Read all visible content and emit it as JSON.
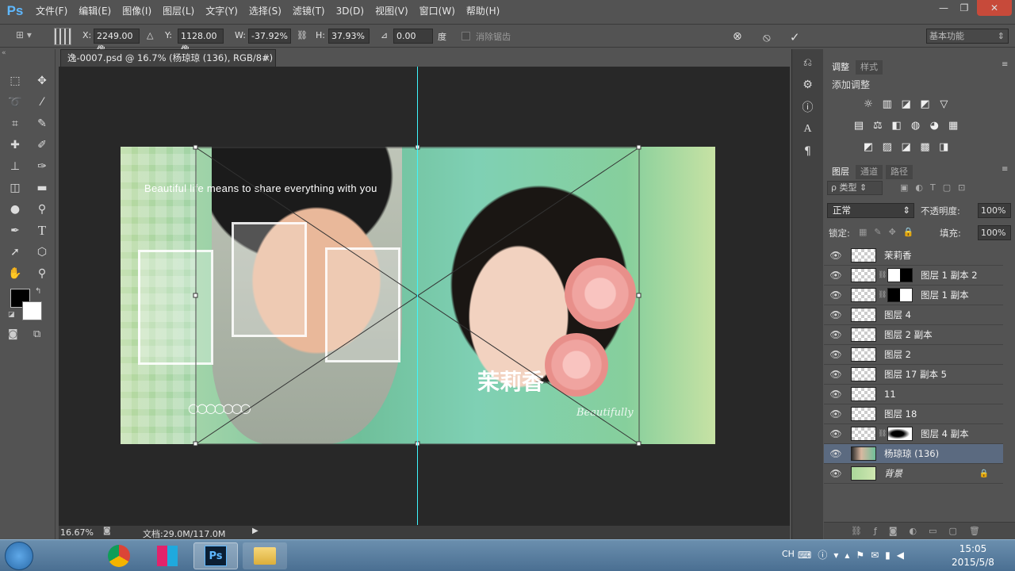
{
  "app": {
    "logo": "Ps"
  },
  "menu": [
    "文件(F)",
    "编辑(E)",
    "图像(I)",
    "图层(L)",
    "文字(Y)",
    "选择(S)",
    "滤镜(T)",
    "3D(D)",
    "视图(V)",
    "窗口(W)",
    "帮助(H)"
  ],
  "window_controls": [
    "—",
    "❐",
    "✕"
  ],
  "options": {
    "x_label": "X:",
    "x_value": "2249.00 像",
    "y_label": "Y:",
    "y_value": "1128.00 像",
    "w_label": "W:",
    "w_value": "-37.92%",
    "h_label": "H:",
    "h_value": "37.93%",
    "angle_value": "0.00",
    "angle_unit": "度",
    "antialias_label": "消除锯齿",
    "workspace": "基本功能"
  },
  "document": {
    "tab_title": "逸-0007.psd @ 16.7% (杨琼琼 (136), RGB/8#)",
    "tab_close": "×",
    "slogan": "Beautiful life means to share everything with you",
    "logo_text": "茉莉香",
    "logo_script": "Beautifully"
  },
  "status": {
    "zoom": "16.67%",
    "doc_info": "文档:29.0M/117.0M"
  },
  "adjustments": {
    "tabs": [
      "调整",
      "样式"
    ],
    "heading": "添加调整",
    "icons_row1": [
      "☼",
      "▥",
      "◪",
      "◩",
      "▽"
    ],
    "icons_row2": [
      "▤",
      "⚖",
      "◧",
      "◍",
      "◕",
      "▦"
    ],
    "icons_row3": [
      "◩",
      "▨",
      "◪",
      "▩",
      "◨"
    ]
  },
  "layers": {
    "tabs": [
      "图层",
      "通道",
      "路径"
    ],
    "filter_label": "ρ 类型",
    "blend_mode": "正常",
    "opacity_label": "不透明度:",
    "opacity_value": "100%",
    "lock_label": "锁定:",
    "fill_label": "填充:",
    "fill_value": "100%",
    "items": [
      {
        "name": "茉莉香"
      },
      {
        "name": "图层 1 副本 2"
      },
      {
        "name": "图层 1 副本"
      },
      {
        "name": "图层 4"
      },
      {
        "name": "图层 2 副本"
      },
      {
        "name": "图层 2"
      },
      {
        "name": "图层 17 副本 5"
      },
      {
        "name": "11"
      },
      {
        "name": "图层 18"
      },
      {
        "name": "图层 4 副本"
      },
      {
        "name": "杨琼琼 (136)"
      },
      {
        "name": "背景"
      }
    ]
  },
  "taskbar": {
    "lang": "CH",
    "time": "15:05",
    "date": "2015/5/8",
    "ps_label": "Ps"
  }
}
